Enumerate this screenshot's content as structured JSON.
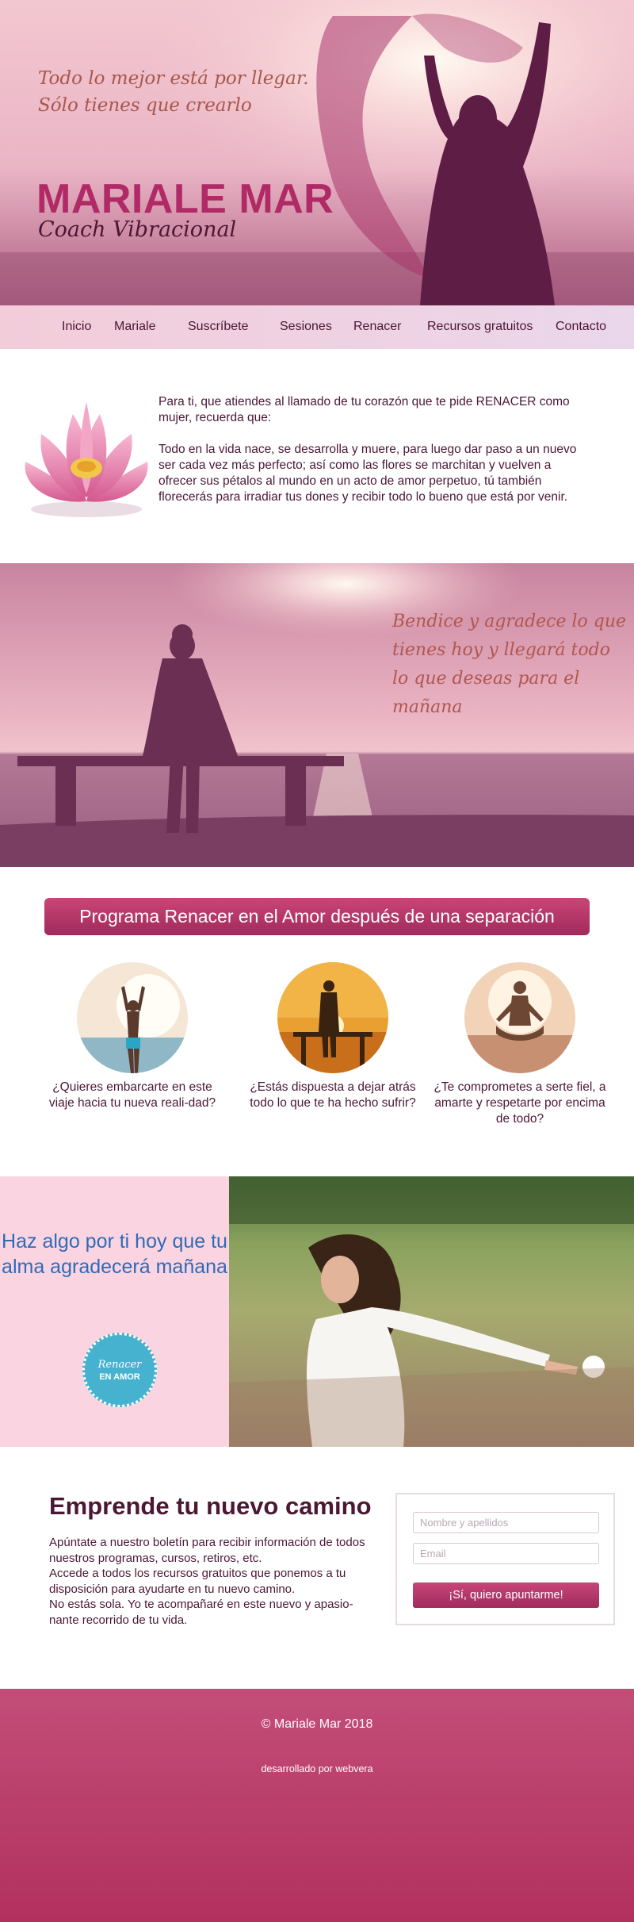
{
  "hero": {
    "quote_line1": "Todo lo mejor está por llegar.",
    "quote_line2": "Sólo tienes que crearlo",
    "name": "MARIALE MAR",
    "role": "Coach Vibracional"
  },
  "nav": {
    "items": [
      "Inicio",
      "Mariale",
      "Suscríbete",
      "Sesiones",
      "Renacer",
      "Recursos gratuitos",
      "Contacto"
    ]
  },
  "intro": {
    "paragraph1": "Para ti, que atiendes al llamado de tu corazón que te pide RENACER como mujer, recuerda que:",
    "paragraph2": "Todo en la vida nace, se desarrolla y muere, para luego dar paso a un nuevo ser cada vez más perfecto; así como las flores se marchitan y vuelven a ofrecer sus pétalos al mundo en un acto de amor perpetuo, tú también florecerás para irradiar tus dones y recibir todo lo bueno que está por venir."
  },
  "sunset": {
    "quote": "Bendice y agradece lo que tienes hoy y llegará todo lo que deseas para el mañana"
  },
  "program": {
    "title": "Programa Renacer en el Amor después de una separación",
    "questions": [
      "¿Quieres embarcarte en este viaje hacia tu nueva reali-dad?",
      "¿Estás dispuesta a dejar atrás todo lo que te ha hecho sufrir?",
      "¿Te comprometes a serte fiel, a amarte y respetarte por encima de todo?"
    ]
  },
  "soul": {
    "headline": "Haz algo por ti hoy que tu alma agradecerá mañana",
    "badge_script": "Renacer",
    "badge_caps": "EN AMOR"
  },
  "signup": {
    "title": "Emprende tu nuevo camino",
    "desc_line1": "Apúntate a nuestro boletín para recibir información de todos nuestros programas, cursos, retiros, etc.",
    "desc_line2": "Accede a todos los recursos gratuitos que ponemos a tu disposición para ayudarte en tu nuevo camino.",
    "desc_line3": "No estás sola. Yo te acompañaré en este nuevo y apasio-nante recorrido de tu vida.",
    "name_placeholder": "Nombre y apellidos",
    "email_placeholder": "Email",
    "submit_label": "¡Sí, quiero apuntarme!"
  },
  "footer": {
    "copyright": "© Mariale Mar 2018",
    "developer": "desarrollado por webvera"
  },
  "colors": {
    "brand": "#b02a66",
    "text": "#4b1735",
    "headline_blue": "#2e6bb8",
    "badge": "#47b2cf"
  }
}
